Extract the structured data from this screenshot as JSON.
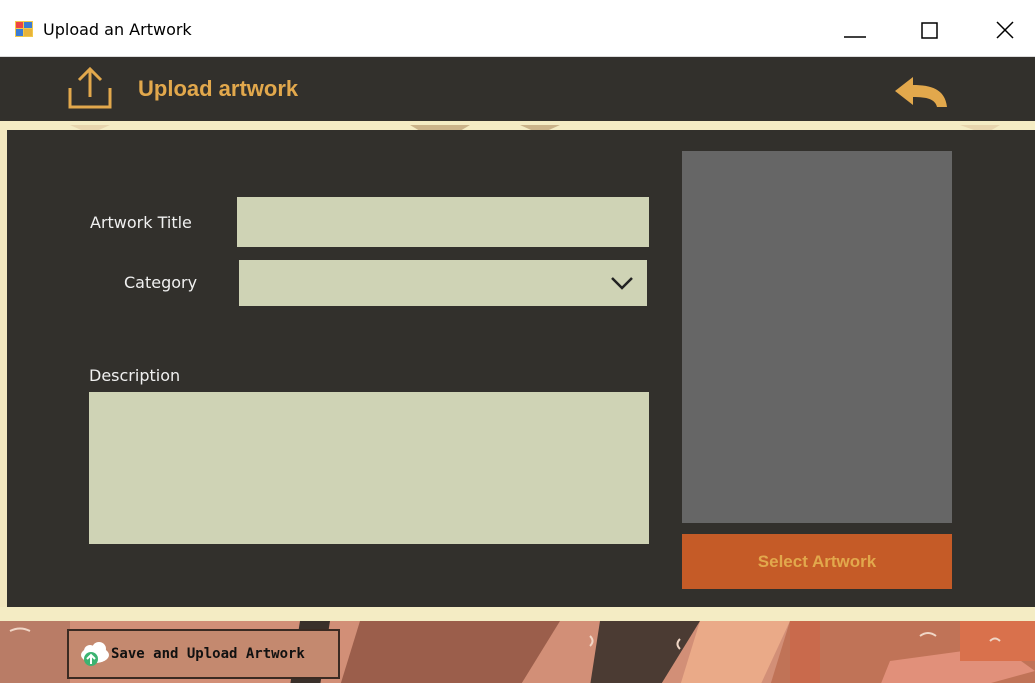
{
  "window": {
    "title": "Upload an Artwork",
    "controls": [
      "minimize",
      "maximize",
      "close"
    ]
  },
  "header": {
    "title": "Upload artwork",
    "icons": {
      "upload": "upload-icon",
      "back": "back-arrow-icon"
    }
  },
  "form": {
    "title_label": "Artwork Title",
    "title_value": "",
    "category_label": "Category",
    "category_value": "",
    "description_label": "Description",
    "description_value": ""
  },
  "preview": {
    "select_label": "Select Artwork"
  },
  "footer": {
    "save_label": "Save and Upload Artwork",
    "save_icon": "cloud-upload-icon"
  },
  "colors": {
    "accent": "#e2a84c",
    "panel": "#32302c",
    "field": "#cfd3b5",
    "button": "#c55b27",
    "preview": "#666666"
  }
}
